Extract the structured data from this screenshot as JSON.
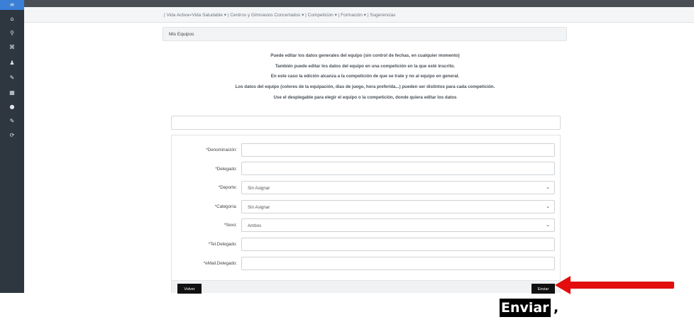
{
  "nav": {
    "links": "| Vida Activa=Vida Saludable ▾  |  Centros y Gimnasios Concertados ▾  |  Competicion ▾  |  Formación ▾  |  Sugerencias"
  },
  "sidebar": {
    "icons": [
      {
        "name": "menu-icon",
        "glyph": "≡"
      },
      {
        "name": "home-icon",
        "glyph": "⌂"
      },
      {
        "name": "search-icon",
        "glyph": "⚲"
      },
      {
        "name": "network-icon",
        "glyph": "⌘"
      },
      {
        "name": "user-icon",
        "glyph": "♟"
      },
      {
        "name": "pencil-icon",
        "glyph": "✎"
      },
      {
        "name": "grid-icon",
        "glyph": "▦"
      },
      {
        "name": "settings-icon",
        "glyph": "●"
      },
      {
        "name": "edit-icon",
        "glyph": "✎"
      },
      {
        "name": "logout-icon",
        "glyph": "⟳"
      }
    ]
  },
  "page": {
    "title": "Mis Equipos"
  },
  "info": {
    "lines": [
      "Puede editar los datos generales del equipo (sin control de fechas, en cualquier momento)",
      "También puede editar los datos del equipo en una competición en la que esté inscrito.",
      "En este caso la edición alcanza a la competición de que se trate y  no al equipo en general.",
      "Los datos del equipo (colores de la equipación, dias de juego, hora preferida...) pueden ser distintos para cada competición.",
      "Use el desplegable para elegir el equipo o la competición, donde quiera editar los datos"
    ]
  },
  "form": {
    "denominacion_label": "*Denominación:",
    "delegado_label": "*Delegado:",
    "deporte_label": "*Deporte:",
    "deporte_value": "Sin Asignar",
    "categoria_label": "*Categoría:",
    "categoria_value": "Sin Asignar",
    "sexo_label": "*Sexo:",
    "sexo_value": "Ambos",
    "tel_label": "*Tel.Delegado:",
    "email_label": "*eMail.Delegado:",
    "chevron": "⌄"
  },
  "buttons": {
    "volver": "Volver",
    "enviar": "Enviar"
  },
  "annotation": {
    "callout_label": "Enviar",
    "callout_suffix": ",",
    "arrow_color": "#e30d0d"
  }
}
